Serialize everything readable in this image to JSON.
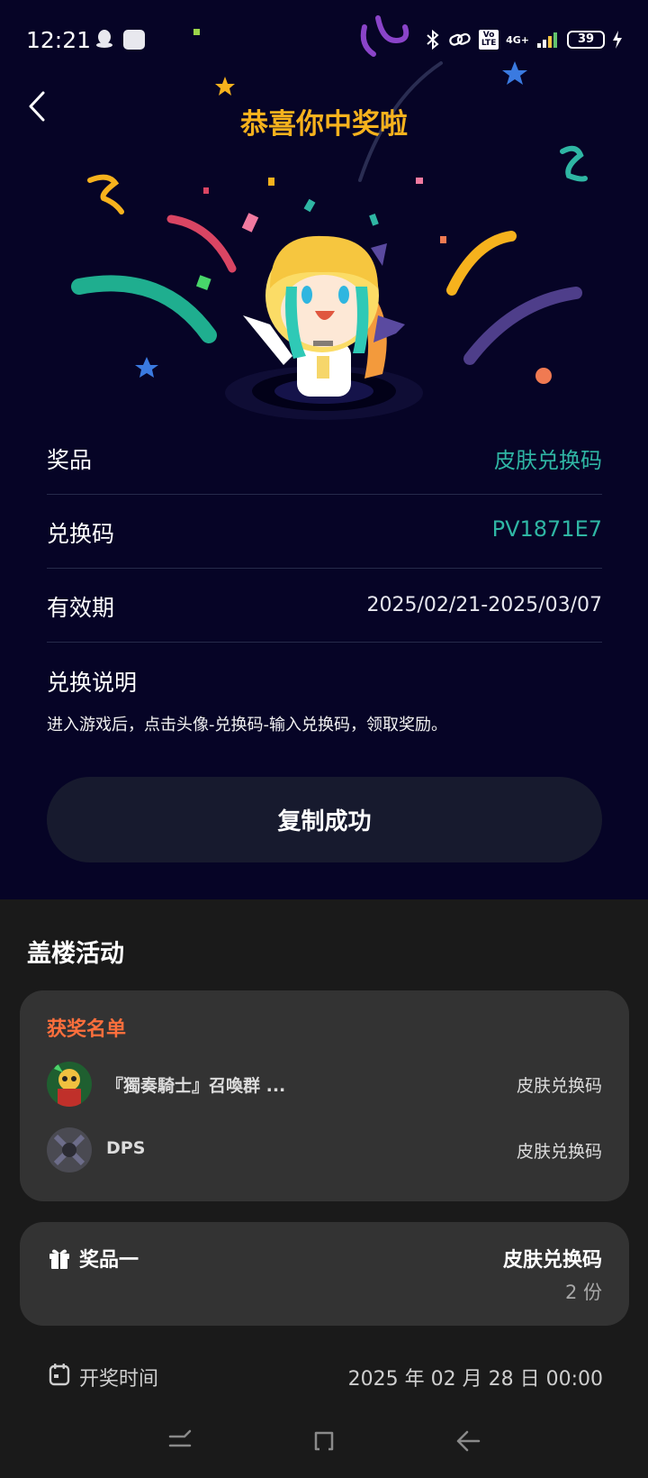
{
  "status_bar": {
    "time": "12:21",
    "network": "4G+",
    "volte": "Vo LTE",
    "battery": "39"
  },
  "header": {
    "title": "恭喜你中奖啦"
  },
  "info": {
    "prize_label": "奖品",
    "prize_value": "皮肤兑换码",
    "code_label": "兑换码",
    "code_value": "PV1871E7",
    "validity_label": "有效期",
    "validity_value": "2025/02/21-2025/03/07",
    "explain_title": "兑换说明",
    "explain_text": "进入游戏后，点击头像-兑换码-输入兑换码，领取奖励。"
  },
  "copy_button": {
    "label": "复制成功"
  },
  "activity": {
    "section_title": "盖楼活动",
    "winners_title": "获奖名单",
    "winners": [
      {
        "name": "『獨奏騎士』召喚群 ...",
        "prize": "皮肤兑换码"
      },
      {
        "name": "DPS",
        "prize": "皮肤兑换码"
      }
    ],
    "prize_card": {
      "label": "奖品一",
      "name": "皮肤兑换码",
      "count": "2 份"
    },
    "draw_time": {
      "label": "开奖时间",
      "value": "2025 年 02 月 28 日 00:00"
    }
  },
  "colors": {
    "accent_gold": "#f6b21d",
    "teal": "#2fb6a4",
    "orange": "#ff6f3c",
    "dark_bg": "#060426"
  },
  "icons": [
    "back-arrow-icon",
    "gift-icon",
    "calendar-icon",
    "recent-apps-icon",
    "home-icon",
    "back-nav-icon"
  ]
}
